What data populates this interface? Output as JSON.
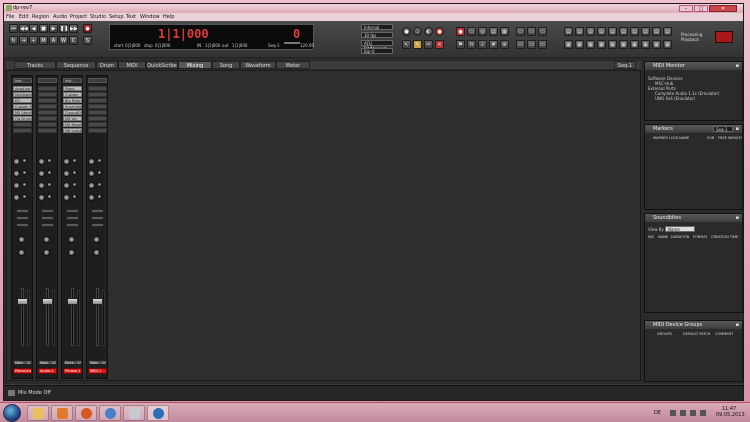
{
  "window": {
    "title": "dp-rev7"
  },
  "menubar": {
    "items": [
      "File",
      "Edit",
      "Region",
      "Audio",
      "Project",
      "Studio",
      "Setup",
      "Text",
      "Window",
      "Help"
    ]
  },
  "transport": {
    "start_label": "start",
    "start_value": "0|1|000",
    "stop_label": "stop",
    "stop_value": "0|1|000",
    "time_main": "1|1|000",
    "time_right": "0",
    "in_label": "IN",
    "in_value": "1|1|000",
    "out_label": "out",
    "out_value": "1|1|000",
    "seq_label": "Seq-1",
    "tempo_value": "120.00",
    "dropdowns": [
      "Internal",
      "30 fps",
      "AFU Bit/Nearest",
      "Bar-0"
    ]
  },
  "processing": {
    "label_line1": "Processing",
    "label_line2": "Playback"
  },
  "tabs": [
    "Tracks",
    "Sequence",
    "Drum",
    "MIDI",
    "QuickScribe",
    "Mixing Board",
    "Song",
    "Waveform",
    "Meter Bridge"
  ],
  "active_tab": "Mixing Board",
  "tab_options_label": "Seq-1",
  "mixer": {
    "strips": [
      {
        "sel": "Inst - playback",
        "inserts": [
          "AmpLive",
          "Multiband",
          "EQ",
          "Custom 1B",
          "MX Stereo",
          "Fat Drums"
        ],
        "io": "Main - 1/2",
        "name": "PianoLine"
      },
      {
        "sel": "",
        "inserts": [],
        "io": "Main - 1/2",
        "name": "Audio-1"
      },
      {
        "sel": "Inst - playback",
        "inserts": [
          "Piano",
          "Custom",
          "Big Mute",
          "Ensemble",
          "ChorusEnd",
          "MX Ver",
          "MX Reverb",
          "MX Leslie"
        ],
        "io": "Mute - 1/2",
        "name": "Phrase-1"
      },
      {
        "sel": "",
        "inserts": [],
        "io": "Main - 1/2",
        "name": "MIDI-1"
      }
    ]
  },
  "panels": {
    "midi_monitor": {
      "title": "MIDI Monitor",
      "tree": [
        "Software Devices",
        "MSC-Hub",
        "External Ports",
        "Complete Audio 1.1x (Emulator)",
        "UNO 4x4 (Emulator)"
      ]
    },
    "markers": {
      "title": "Markers",
      "seq": "Seq-1",
      "columns": [
        "MARKER",
        "LOCK",
        "NAME",
        "SUB",
        "FREE WEIGHT"
      ]
    },
    "soundbites": {
      "title": "Soundbites",
      "view_label": "View By",
      "view_value": "Name",
      "columns": [
        "INS",
        "NAME",
        "DURATION",
        "FORMAT",
        "CREATION TIME"
      ]
    },
    "midi_device_groups": {
      "title": "MIDI Device Groups",
      "columns": [
        "GROUPS",
        "DEFAULT PATCH",
        "COMMENT"
      ]
    }
  },
  "statusbar": {
    "text": "Mix Mode Off"
  },
  "taskbar": {
    "lang": "DE",
    "time": "11:47",
    "date": "09.05.2013",
    "apps": [
      "explorer-icon",
      "media-player-icon",
      "firefox-icon",
      "network-icon",
      "dp-icon",
      "dp-app-icon"
    ]
  },
  "colors": {
    "accent_red": "#d21e1e",
    "time_red": "#e23a3a"
  }
}
